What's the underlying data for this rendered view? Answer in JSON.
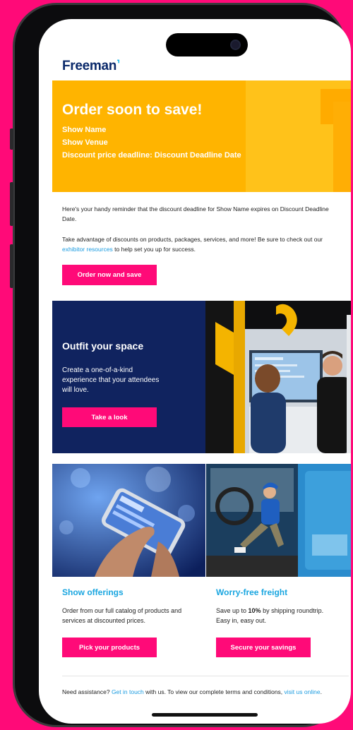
{
  "brand": {
    "name": "Freeman",
    "mark": "⸣"
  },
  "hero": {
    "title": "Order soon to save!",
    "show_name": "Show Name",
    "show_venue": "Show Venue",
    "deadline": "Discount price deadline: Discount Deadline Date"
  },
  "intro": {
    "p1": "Here's your handy reminder that the discount deadline for Show Name expires on Discount Deadline Date.",
    "p2_before": "Take advantage of discounts on products, packages, services, and more! Be sure to check out our ",
    "p2_link": "exhibitor resources",
    "p2_after": " to help set you up for success.",
    "cta": "Order now and save"
  },
  "outfit": {
    "title": "Outfit your space",
    "desc": "Create a one-of-a-kind experience that your attendees will love.",
    "cta": "Take a look"
  },
  "offerings": {
    "title": "Show offerings",
    "desc": "Order from our full catalog of products and services at discounted prices.",
    "cta": "Pick your products"
  },
  "freight": {
    "title": "Worry-free freight",
    "desc_before": "Save up to ",
    "desc_bold": "10%",
    "desc_after": " by shipping roundtrip. Easy in, easy out.",
    "cta": "Secure your savings"
  },
  "footer": {
    "t1": "Need assistance? ",
    "link1": "Get in touch",
    "t2": " with us. To view our complete terms and conditions, ",
    "link2": "visit us online",
    "t3": "."
  },
  "colors": {
    "pink": "#ff0a78",
    "navy": "#10235f",
    "gold": "#ffb400",
    "link": "#1a9be0"
  }
}
